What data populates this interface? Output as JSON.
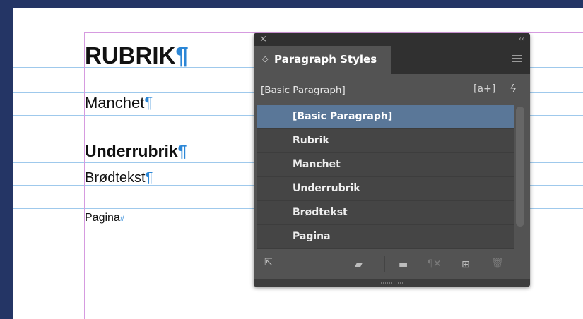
{
  "document": {
    "colors": {
      "page": "#ffffff",
      "pasteboard": "#243565",
      "baseline_grid": "#9fc9ec",
      "margin_guide": "#d69be0",
      "pilcrow": "#2b86d6"
    },
    "texts": [
      {
        "text": "RUBRIK",
        "mark": "¶"
      },
      {
        "text": "Manchet",
        "mark": "¶"
      },
      {
        "text": "Underrubrik",
        "mark": "¶"
      },
      {
        "text": "Brødtekst",
        "mark": "¶"
      },
      {
        "text": "Pagina",
        "mark": "#"
      }
    ]
  },
  "panel": {
    "close_glyph": "×",
    "collapse_glyph": "‹‹",
    "tab": {
      "chevron": "◇",
      "label": "Paragraph Styles"
    },
    "menu_icon": "panel-menu-icon",
    "current_style": "[Basic Paragraph]",
    "new_override_glyph": "[a+]",
    "quick_apply_glyph": "ϟ",
    "styles": [
      {
        "label": "[Basic Paragraph]",
        "selected": true
      },
      {
        "label": "Rubrik",
        "selected": false
      },
      {
        "label": "Manchet",
        "selected": false
      },
      {
        "label": "Underrubrik",
        "selected": false
      },
      {
        "label": "Brødtekst",
        "selected": false
      },
      {
        "label": "Pagina",
        "selected": false
      }
    ],
    "footer_icons": {
      "load": "⇱",
      "group_from_styles": "▰",
      "new_group": "▬",
      "clear_overrides": "¶✕",
      "new_style": "⊞",
      "delete": "🗑"
    },
    "colors": {
      "panel": "#535353",
      "titlebar": "#303030",
      "list": "#454545",
      "selected": "#5a7798"
    }
  }
}
